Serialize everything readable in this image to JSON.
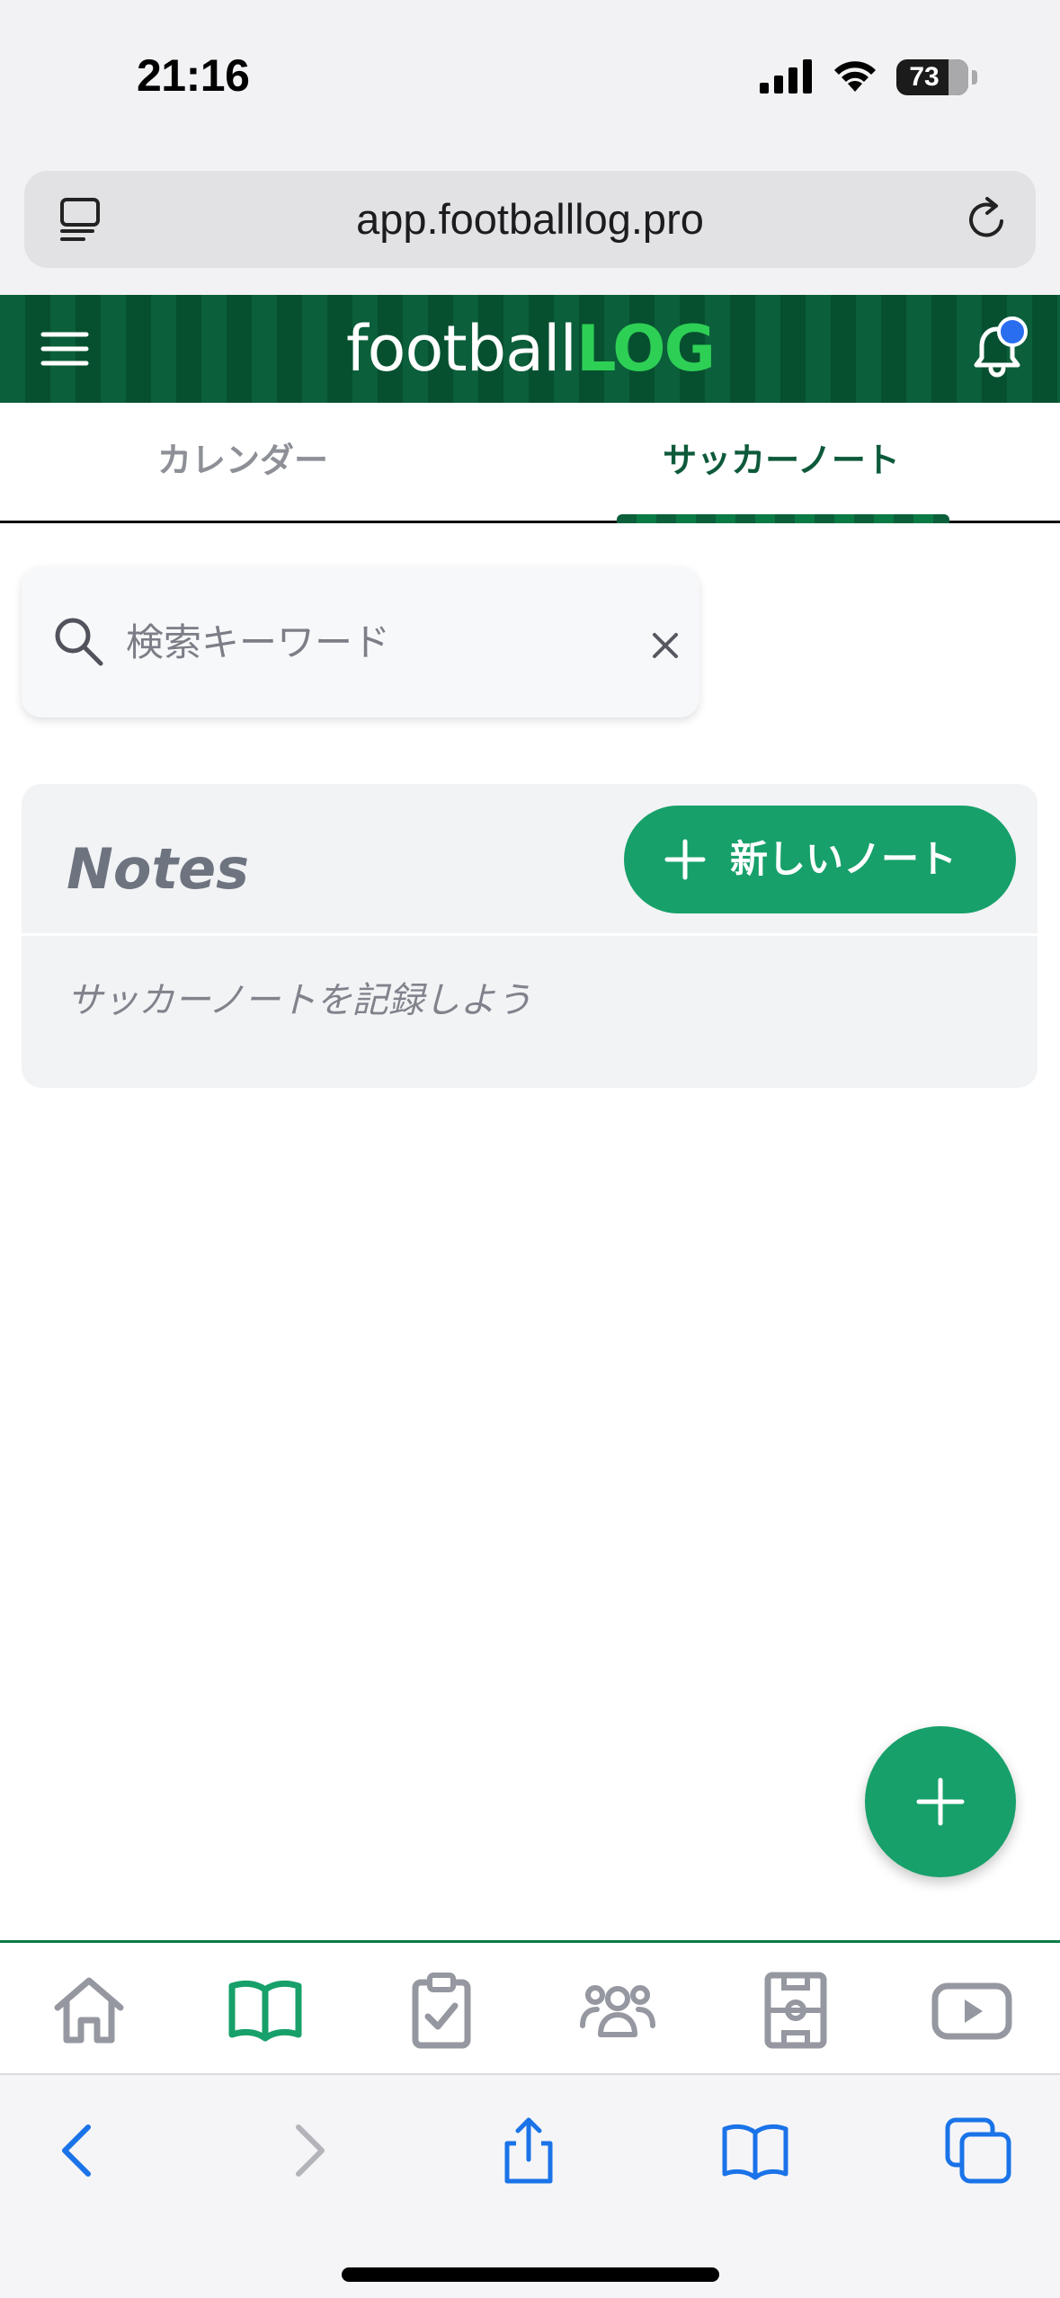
{
  "status_bar": {
    "time": "21:16",
    "battery_percent": "73",
    "battery_level": 0.73
  },
  "browser": {
    "url": "app.footballlog.pro"
  },
  "header": {
    "logo_part1": "football",
    "logo_part2": "LOG",
    "has_notification": true,
    "brand_color": "#0b5f3a",
    "accent_color": "#2ecf55"
  },
  "tabs": [
    {
      "label": "カレンダー",
      "active": false
    },
    {
      "label": "サッカーノート",
      "active": true
    }
  ],
  "search": {
    "placeholder": "検索キーワード",
    "value": ""
  },
  "notes": {
    "title": "Notes",
    "new_note_label": "新しいノート",
    "empty_message": "サッカーノートを記録しよう",
    "button_color": "#17a06a"
  },
  "bottom_nav": [
    {
      "icon": "home-icon",
      "active": false
    },
    {
      "icon": "book-icon",
      "active": true
    },
    {
      "icon": "clipboard-check-icon",
      "active": false
    },
    {
      "icon": "team-icon",
      "active": false
    },
    {
      "icon": "field-icon",
      "active": false
    },
    {
      "icon": "video-icon",
      "active": false
    }
  ],
  "safari_toolbar": [
    {
      "icon": "back-icon",
      "enabled": true
    },
    {
      "icon": "forward-icon",
      "enabled": false
    },
    {
      "icon": "share-icon",
      "enabled": true
    },
    {
      "icon": "bookmarks-icon",
      "enabled": true
    },
    {
      "icon": "tabs-icon",
      "enabled": true
    }
  ]
}
